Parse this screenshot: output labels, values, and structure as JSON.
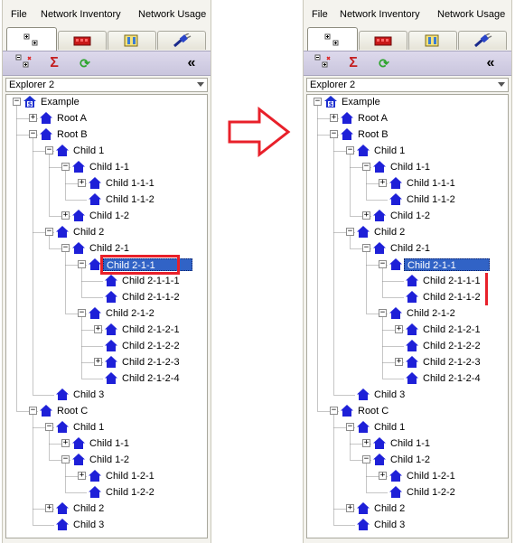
{
  "menu": [
    "File",
    "Network Inventory",
    "Network Usage"
  ],
  "tabs": [
    {
      "icon": "tree-view-icon",
      "active": true
    },
    {
      "icon": "device-icon",
      "active": false
    },
    {
      "icon": "tools-icon",
      "active": false
    },
    {
      "icon": "plug-icon",
      "active": false
    }
  ],
  "toolbar": {
    "icons": [
      "expand-collapse-icon",
      "sigma-icon",
      "refresh-icon"
    ],
    "sigma": "Σ",
    "refresh": "⟳",
    "collapse": "«"
  },
  "explorer": {
    "selected": "Explorer 2"
  },
  "colors": {
    "selection": "#3163c6",
    "highlight": "#e8202a",
    "node_icon": "#1e20d8",
    "root_icon": "#1d2fd0"
  },
  "left_tree": [
    {
      "label": "Example",
      "depth": 0,
      "exp": "-",
      "root": true
    },
    {
      "label": "Root A",
      "depth": 1,
      "exp": "+"
    },
    {
      "label": "Root B",
      "depth": 1,
      "exp": "-"
    },
    {
      "label": "Child 1",
      "depth": 2,
      "exp": "-"
    },
    {
      "label": "Child 1-1",
      "depth": 3,
      "exp": "-"
    },
    {
      "label": "Child 1-1-1",
      "depth": 4,
      "exp": "+"
    },
    {
      "label": "Child 1-1-2",
      "depth": 4,
      "exp": ""
    },
    {
      "label": "Child 1-2",
      "depth": 3,
      "exp": "+"
    },
    {
      "label": "Child 2",
      "depth": 2,
      "exp": "-"
    },
    {
      "label": "Child 2-1",
      "depth": 3,
      "exp": "-"
    },
    {
      "label": "Child 2-1-1",
      "depth": 4,
      "exp": "-",
      "selected": true
    },
    {
      "label": "Child 2-1-1-1",
      "depth": 5,
      "exp": ""
    },
    {
      "label": "Child 2-1-1-2",
      "depth": 5,
      "exp": ""
    },
    {
      "label": "Child 2-1-2",
      "depth": 4,
      "exp": "-"
    },
    {
      "label": "Child 2-1-2-1",
      "depth": 5,
      "exp": "+"
    },
    {
      "label": "Child 2-1-2-2",
      "depth": 5,
      "exp": ""
    },
    {
      "label": "Child 2-1-2-3",
      "depth": 5,
      "exp": "+"
    },
    {
      "label": "Child 2-1-2-4",
      "depth": 5,
      "exp": ""
    },
    {
      "label": "Child 3",
      "depth": 2,
      "exp": ""
    },
    {
      "label": "Root C",
      "depth": 1,
      "exp": "-"
    },
    {
      "label": "Child 1",
      "depth": 2,
      "exp": "-"
    },
    {
      "label": "Child 1-1",
      "depth": 3,
      "exp": "+"
    },
    {
      "label": "Child 1-2",
      "depth": 3,
      "exp": "-"
    },
    {
      "label": "Child 1-2-1",
      "depth": 4,
      "exp": "+"
    },
    {
      "label": "Child 1-2-2",
      "depth": 4,
      "exp": ""
    },
    {
      "label": "Child 2",
      "depth": 2,
      "exp": "+"
    },
    {
      "label": "Child 3",
      "depth": 2,
      "exp": ""
    }
  ],
  "right_tree": [
    {
      "label": "Example",
      "depth": 0,
      "exp": "-",
      "root": true
    },
    {
      "label": "Root A",
      "depth": 1,
      "exp": "+"
    },
    {
      "label": "Root B",
      "depth": 1,
      "exp": "-"
    },
    {
      "label": "Child 1",
      "depth": 2,
      "exp": "-"
    },
    {
      "label": "Child 1-1",
      "depth": 3,
      "exp": "-"
    },
    {
      "label": "Child 1-1-1",
      "depth": 4,
      "exp": "+"
    },
    {
      "label": "Child 1-1-2",
      "depth": 4,
      "exp": ""
    },
    {
      "label": "Child 1-2",
      "depth": 3,
      "exp": "+"
    },
    {
      "label": "Child 2",
      "depth": 2,
      "exp": "-"
    },
    {
      "label": "Child 2-1",
      "depth": 3,
      "exp": "-"
    },
    {
      "label": "Child 2-1-1",
      "depth": 4,
      "exp": "-",
      "selected": true,
      "wide": true
    },
    {
      "label": "Child 2-1-1-1",
      "depth": 5,
      "exp": ""
    },
    {
      "label": "Child 2-1-1-2",
      "depth": 5,
      "exp": ""
    },
    {
      "label": "Child 2-1-2",
      "depth": 4,
      "exp": "-"
    },
    {
      "label": "Child 2-1-2-1",
      "depth": 5,
      "exp": "+"
    },
    {
      "label": "Child 2-1-2-2",
      "depth": 5,
      "exp": ""
    },
    {
      "label": "Child 2-1-2-3",
      "depth": 5,
      "exp": "+"
    },
    {
      "label": "Child 2-1-2-4",
      "depth": 5,
      "exp": ""
    },
    {
      "label": "Child 3",
      "depth": 2,
      "exp": ""
    },
    {
      "label": "Root C",
      "depth": 1,
      "exp": "-"
    },
    {
      "label": "Child 1",
      "depth": 2,
      "exp": "-"
    },
    {
      "label": "Child 1-1",
      "depth": 3,
      "exp": "+"
    },
    {
      "label": "Child 1-2",
      "depth": 3,
      "exp": "-"
    },
    {
      "label": "Child 1-2-1",
      "depth": 4,
      "exp": "+"
    },
    {
      "label": "Child 1-2-2",
      "depth": 4,
      "exp": ""
    },
    {
      "label": "Child 2",
      "depth": 2,
      "exp": "+"
    },
    {
      "label": "Child 3",
      "depth": 2,
      "exp": ""
    }
  ]
}
